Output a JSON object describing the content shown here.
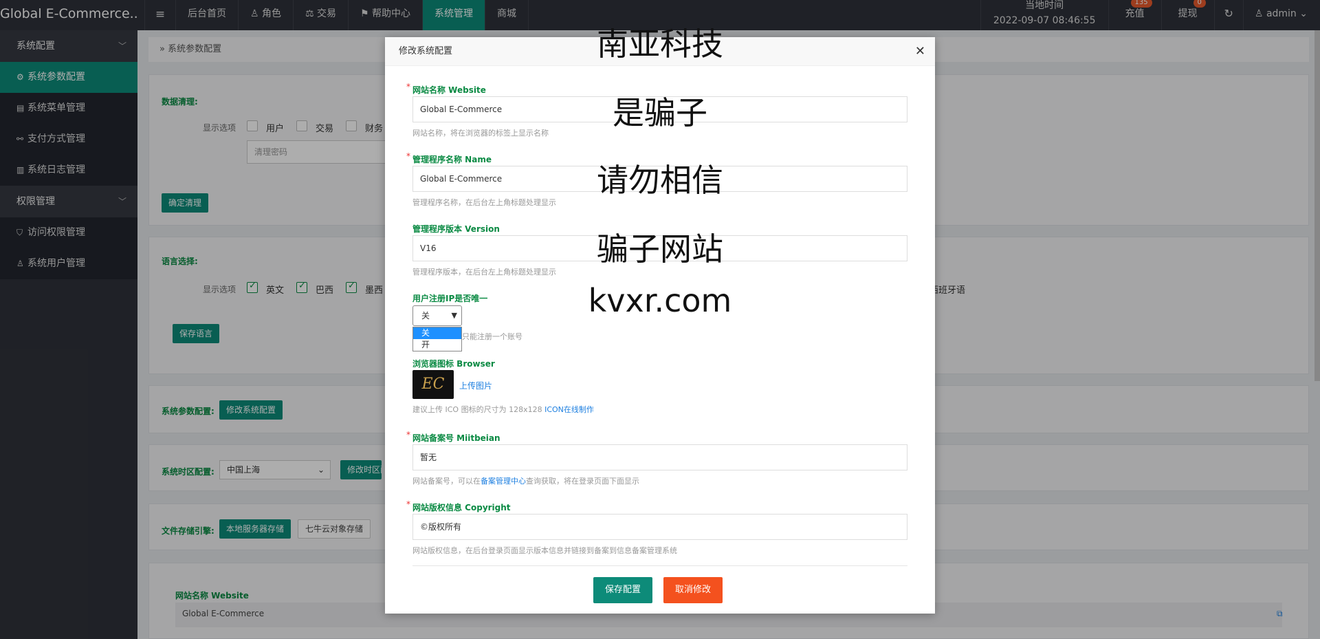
{
  "header": {
    "brand": "Global E-Commerce...",
    "menu_icon": "≡",
    "nav": [
      {
        "icon": "",
        "label": "后台首页"
      },
      {
        "icon": "♙",
        "label": "角色"
      },
      {
        "icon": "⚖",
        "label": "交易"
      },
      {
        "icon": "⚑",
        "label": "帮助中心"
      },
      {
        "icon": "",
        "label": "系统管理"
      },
      {
        "icon": "",
        "label": "商城"
      }
    ],
    "time_label": "当地时间",
    "time_value": "2022-09-07 08:46:55",
    "recharge_label": "充值",
    "recharge_badge": "135",
    "withdraw_label": "提现",
    "withdraw_badge": "0",
    "refresh_icon": "↻",
    "user_label": "admin",
    "user_caret": "⌄"
  },
  "sidebar": {
    "group1": "系统配置",
    "items1": [
      "系统参数配置",
      "系统菜单管理",
      "支付方式管理",
      "系统日志管理"
    ],
    "group2": "权限管理",
    "items2": [
      "访问权限管理",
      "系统用户管理"
    ]
  },
  "content": {
    "breadcrumb": "系统参数配置",
    "clean_title": "数据清理:",
    "show_options": "显示选项",
    "clean_opts": [
      "用户",
      "交易",
      "财务"
    ],
    "clean_pwd_placeholder": "清理密码",
    "confirm_clean": "确定清理",
    "lang_title": "语言选择:",
    "lang_opts": [
      "英文",
      "巴西",
      "墨西"
    ],
    "lang_extra": "西班牙语",
    "save_lang": "保存语言",
    "sys_param_title": "系统参数配置:",
    "modify_sys": "修改系统配置",
    "tz_title": "系统时区配置:",
    "tz_value": "中国上海",
    "modify_tz": "修改时区配",
    "storage_title": "文件存储引擎:",
    "storage_local": "本地服务器存储",
    "storage_qiniu": "七牛云对象存储",
    "bottom_label": "网站名称 Website",
    "bottom_value": "Global E-Commerce"
  },
  "modal": {
    "title": "修改系统配置",
    "close_icon": "✕",
    "fields": {
      "website_label": "网站名称 Website",
      "website_value": "Global E-Commerce",
      "website_help": "网站名称，将在浏览器的标签上显示名称",
      "name_label": "管理程序名称 Name",
      "name_value": "Global E-Commerce",
      "name_help": "管理程序名称，在后台左上角标题处理显示",
      "version_label": "管理程序版本 Version",
      "version_value": "V16",
      "version_help": "管理程序版本，在后台左上角标题处理显示",
      "ip_label": "用户注册IP是否唯一",
      "ip_selected": "关",
      "ip_options": [
        "关",
        "开"
      ],
      "ip_help": "只能注册一个账号",
      "favicon_label": "浏览器图标 Browser",
      "favicon_text": "EC",
      "upload": "上传图片",
      "favicon_help": "建议上传 ICO 图标的尺寸为 128x128",
      "favicon_link": "ICON在线制作",
      "beian_label": "网站备案号 Miitbeian",
      "beian_value": "暂无",
      "beian_help_a": "网站备案号，可以在",
      "beian_help_link": "备案管理中心",
      "beian_help_b": "查询获取，将在登录页面下面显示",
      "copyright_label": "网站版权信息 Copyright",
      "copyright_value": "©版权所有",
      "copyright_help": "网站版权信息，在后台登录页面显示版本信息并链接到备案到信息备案管理系统"
    },
    "save": "保存配置",
    "cancel": "取消修改"
  },
  "watermark": [
    "南亚科技",
    "是骗子",
    "请勿相信",
    "骗子网站",
    "kvxr.com"
  ]
}
